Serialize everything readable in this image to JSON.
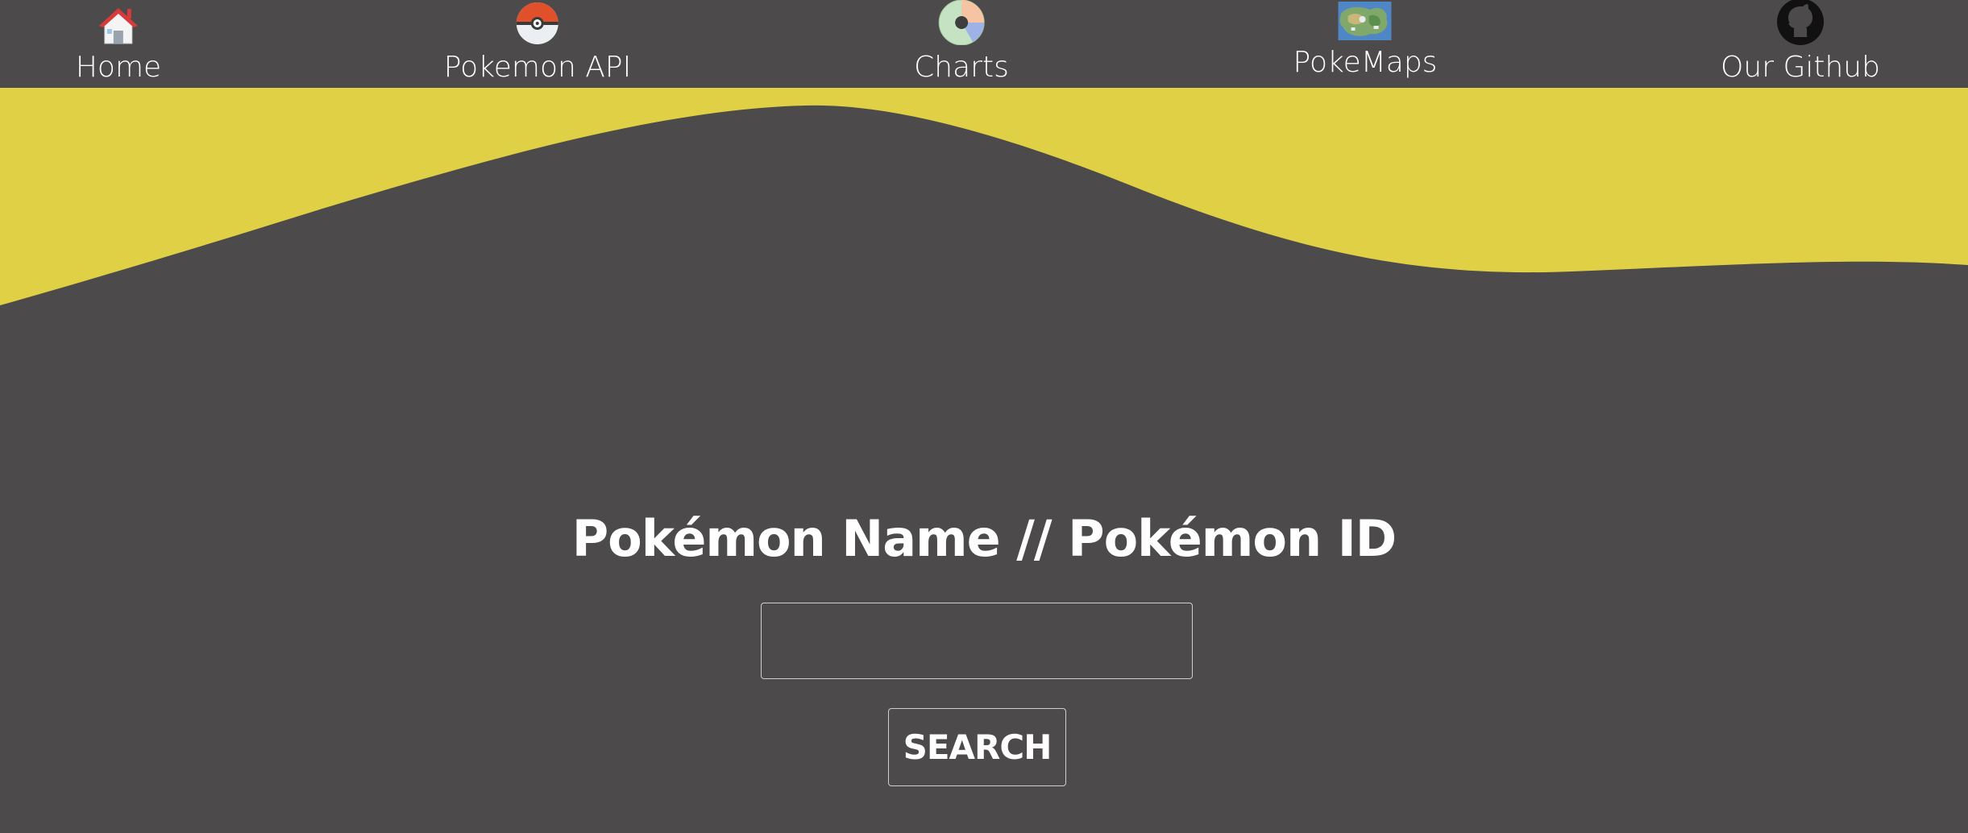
{
  "nav": {
    "items": [
      {
        "label": "Home",
        "icon": "house-icon"
      },
      {
        "label": "Pokemon API",
        "icon": "pokeball-icon"
      },
      {
        "label": "Charts",
        "icon": "pie-chart-icon"
      },
      {
        "label": "PokeMaps",
        "icon": "map-thumbnail-icon"
      },
      {
        "label": "Our Github",
        "icon": "github-icon"
      }
    ]
  },
  "main": {
    "title": "Pokémon Name // Pokémon ID",
    "search": {
      "value": "",
      "placeholder": ""
    },
    "search_button_label": "SEARCH"
  },
  "colors": {
    "background": "#4c4a4a",
    "accent_yellow": "#e0d045",
    "text": "#ffffff"
  }
}
